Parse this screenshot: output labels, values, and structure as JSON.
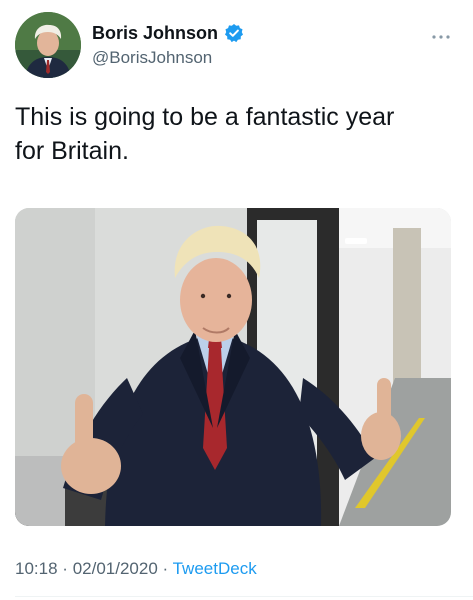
{
  "tweet": {
    "display_name": "Boris Johnson",
    "handle": "@BorisJohnson",
    "verified": true,
    "text_line1": "This is going to be a fantastic year",
    "text_line2": "for Britain.",
    "time": "10:18",
    "date": "02/01/2020",
    "separator": "·",
    "source": "TweetDeck"
  },
  "icons": {
    "verified": "verified-badge-icon",
    "more": "more-options-icon"
  },
  "colors": {
    "accent": "#1d9bf0",
    "text": "#0f1419",
    "muted": "#536471"
  }
}
